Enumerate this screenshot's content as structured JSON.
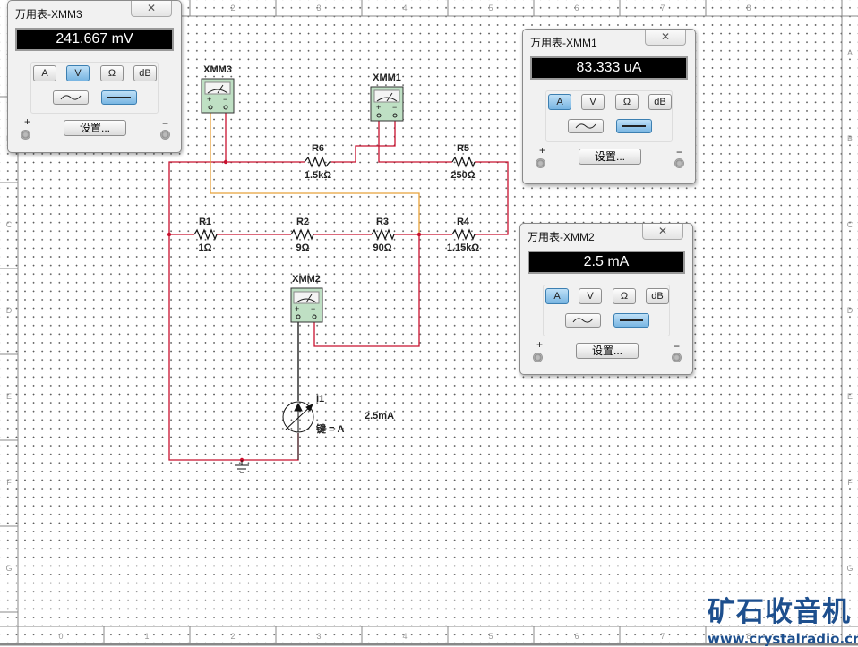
{
  "ruler": {
    "columns": [
      "0",
      "1",
      "2",
      "3",
      "4",
      "5",
      "6",
      "7",
      "8"
    ],
    "rows": [
      "A",
      "B",
      "C",
      "D",
      "E",
      "F",
      "G"
    ]
  },
  "schematic": {
    "resistors": [
      {
        "ref": "R1",
        "value": "1Ω"
      },
      {
        "ref": "R2",
        "value": "9Ω"
      },
      {
        "ref": "R3",
        "value": "90Ω"
      },
      {
        "ref": "R4",
        "value": "1.15kΩ"
      },
      {
        "ref": "R5",
        "value": "250Ω"
      },
      {
        "ref": "R6",
        "value": "1.5kΩ"
      }
    ],
    "meters": {
      "xmm1": "XMM1",
      "xmm2": "XMM2",
      "xmm3": "XMM3"
    },
    "source": {
      "ref": "I1",
      "key": "键 = A",
      "value": "2.5mA"
    },
    "wire_color": "#c8102e",
    "probe_wire_color": "#e8a23a"
  },
  "windows": [
    {
      "title": "万用表-XMM3",
      "reading": "241.667 mV",
      "mode": "V",
      "dc": true,
      "close": "✕",
      "buttons": [
        "A",
        "V",
        "Ω",
        "dB"
      ],
      "settings": "设置...",
      "plus": "+",
      "minus": "−"
    },
    {
      "title": "万用表-XMM1",
      "reading": "83.333 uA",
      "mode": "A",
      "dc": true,
      "close": "✕",
      "buttons": [
        "A",
        "V",
        "Ω",
        "dB"
      ],
      "settings": "设置...",
      "plus": "+",
      "minus": "−"
    },
    {
      "title": "万用表-XMM2",
      "reading": "2.5 mA",
      "mode": "A",
      "dc": true,
      "close": "✕",
      "buttons": [
        "A",
        "V",
        "Ω",
        "dB"
      ],
      "settings": "设置...",
      "plus": "+",
      "minus": "−"
    }
  ],
  "watermark": {
    "title": "矿石收音机",
    "url": "www.crystalradio.cn"
  },
  "colors": {
    "active_button": "#78b5e2",
    "display_bg": "#000000",
    "logo": "#1d4f8e"
  }
}
